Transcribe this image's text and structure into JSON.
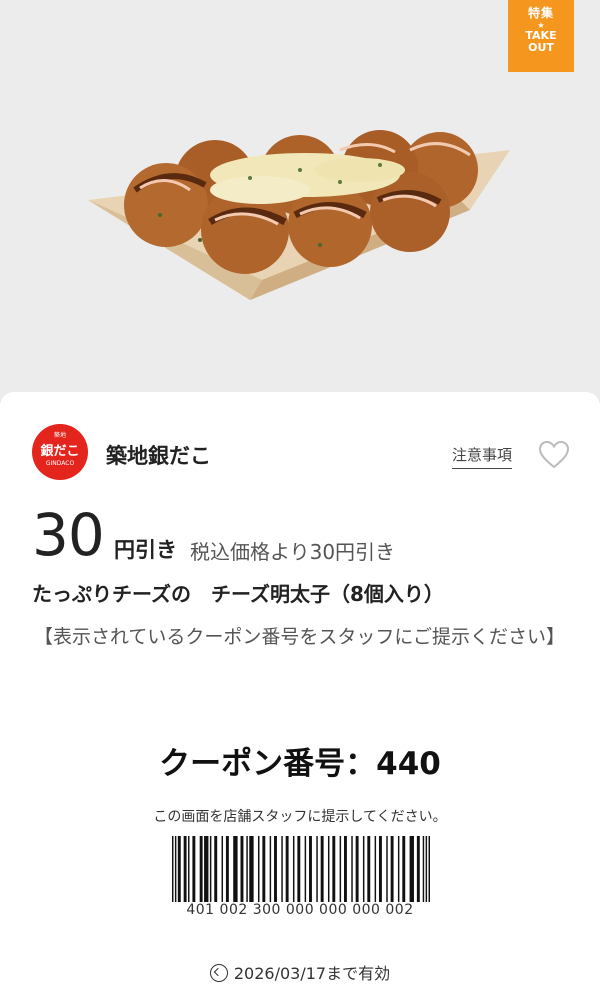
{
  "hero": {
    "image_alt": "takoyaki with cheese and mentaiko in a paper boat",
    "badge": {
      "line1": "特集",
      "line2": "TAKE",
      "line3": "OUT",
      "color": "#f5961e"
    }
  },
  "brand": {
    "name": "築地銀だこ",
    "logo_text": "銀だこ",
    "logo_top_text": "築地",
    "logo_sub_text": "GINDACO",
    "logo_color": "#e3251d"
  },
  "actions": {
    "notes_label": "注意事項",
    "favorite_icon": "heart-outline-icon"
  },
  "discount": {
    "amount": "30",
    "unit": "円引き",
    "description": "税込価格より30円引き"
  },
  "product": {
    "name": "たっぷりチーズの　チーズ明太子（8個入り）"
  },
  "instruction": "【表示されているクーポン番号をスタッフにご提示ください】",
  "coupon": {
    "number_label": "クーポン番号：440",
    "present_note": "この画面を店舗スタッフに提示してください。",
    "barcode_digits": "401 002 300 000 000 000 002"
  },
  "expiry": {
    "icon": "clock-icon",
    "text": "2026/03/17まで有効"
  }
}
